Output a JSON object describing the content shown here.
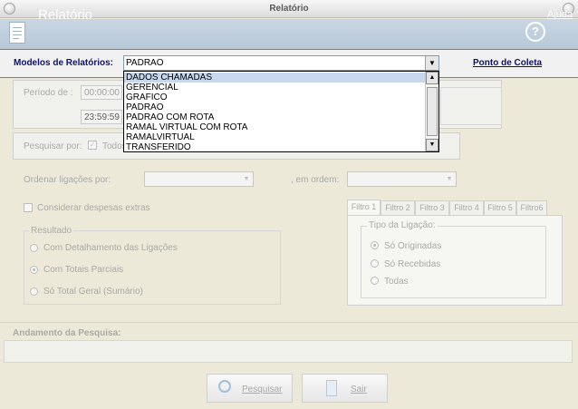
{
  "window": {
    "title": "Relatório"
  },
  "header": {
    "title": "Relatório",
    "help_label": "Ajuda"
  },
  "models": {
    "label": "Modelos de Relatórios:",
    "selected": "PADRAO",
    "options": [
      "DADOS CHAMADAS",
      "GERENCIAL",
      "GRAFICO",
      "PADRAO",
      "PADRAO COM ROTA",
      "RAMAL VIRTUAL COM ROTA",
      "RAMALVIRTUAL",
      "TRANSFERIDO"
    ],
    "highlighted_option": "DADOS CHAMADAS"
  },
  "collection_point_link": "Ponto de Coleta",
  "period": {
    "label": "Período de :",
    "start_time": "00:00:00",
    "end_time": "23:59:59"
  },
  "search_by": {
    "label": "Pesquisar por:",
    "checkbox_label": "Todos"
  },
  "order": {
    "label": "Ordenar ligações por:",
    "order_label": ", em ordem:"
  },
  "extras_checkbox": "Considerar  despesas  extras",
  "result": {
    "label": "Resultado",
    "options": [
      "Com Detalhamento das Ligações",
      "Com Totais  Parciais",
      "Só Total  Geral (Sumário)"
    ],
    "selected_index": 1
  },
  "filters": {
    "tabs": [
      "Filtro 1",
      "Filtro 2",
      "Filtro 3",
      "Filtro 4",
      "Filtro 5",
      "Filtro6"
    ],
    "active_tab": 0,
    "call_type_label": "Tipo da Ligação:",
    "call_type_options": [
      "Só Originadas",
      "Só Recebidas",
      "Todas"
    ],
    "selected_index": 0
  },
  "progress_label": "Andamento da Pesquisa:",
  "buttons": {
    "search": "Pesquisar",
    "exit": "Sair"
  },
  "colors": {
    "header_bg": "#c9d6e4",
    "label_blue": "#10106b",
    "window_bg": "#ece9d8"
  }
}
